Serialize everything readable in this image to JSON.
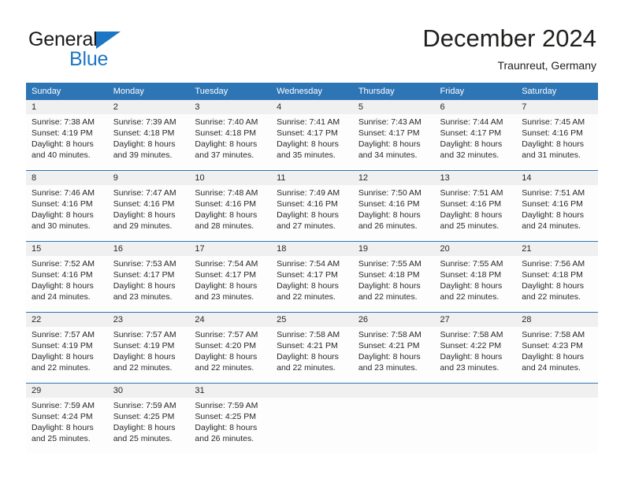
{
  "logo": {
    "word_dark": "General",
    "word_blue": "Blue",
    "triangle_icon": "triangle-icon",
    "accent_color": "#1d76c4"
  },
  "header": {
    "title": "December 2024",
    "subtitle": "Traunreut, Germany"
  },
  "colors": {
    "header_blue": "#2e75b6",
    "daynum_band": "#f0f0f0",
    "text": "#282828"
  },
  "calendar": {
    "weekday_headers": [
      "Sunday",
      "Monday",
      "Tuesday",
      "Wednesday",
      "Thursday",
      "Friday",
      "Saturday"
    ],
    "weeks": [
      [
        {
          "day": "1",
          "lines": [
            "Sunrise: 7:38 AM",
            "Sunset: 4:19 PM",
            "Daylight: 8 hours",
            "and 40 minutes."
          ]
        },
        {
          "day": "2",
          "lines": [
            "Sunrise: 7:39 AM",
            "Sunset: 4:18 PM",
            "Daylight: 8 hours",
            "and 39 minutes."
          ]
        },
        {
          "day": "3",
          "lines": [
            "Sunrise: 7:40 AM",
            "Sunset: 4:18 PM",
            "Daylight: 8 hours",
            "and 37 minutes."
          ]
        },
        {
          "day": "4",
          "lines": [
            "Sunrise: 7:41 AM",
            "Sunset: 4:17 PM",
            "Daylight: 8 hours",
            "and 35 minutes."
          ]
        },
        {
          "day": "5",
          "lines": [
            "Sunrise: 7:43 AM",
            "Sunset: 4:17 PM",
            "Daylight: 8 hours",
            "and 34 minutes."
          ]
        },
        {
          "day": "6",
          "lines": [
            "Sunrise: 7:44 AM",
            "Sunset: 4:17 PM",
            "Daylight: 8 hours",
            "and 32 minutes."
          ]
        },
        {
          "day": "7",
          "lines": [
            "Sunrise: 7:45 AM",
            "Sunset: 4:16 PM",
            "Daylight: 8 hours",
            "and 31 minutes."
          ]
        }
      ],
      [
        {
          "day": "8",
          "lines": [
            "Sunrise: 7:46 AM",
            "Sunset: 4:16 PM",
            "Daylight: 8 hours",
            "and 30 minutes."
          ]
        },
        {
          "day": "9",
          "lines": [
            "Sunrise: 7:47 AM",
            "Sunset: 4:16 PM",
            "Daylight: 8 hours",
            "and 29 minutes."
          ]
        },
        {
          "day": "10",
          "lines": [
            "Sunrise: 7:48 AM",
            "Sunset: 4:16 PM",
            "Daylight: 8 hours",
            "and 28 minutes."
          ]
        },
        {
          "day": "11",
          "lines": [
            "Sunrise: 7:49 AM",
            "Sunset: 4:16 PM",
            "Daylight: 8 hours",
            "and 27 minutes."
          ]
        },
        {
          "day": "12",
          "lines": [
            "Sunrise: 7:50 AM",
            "Sunset: 4:16 PM",
            "Daylight: 8 hours",
            "and 26 minutes."
          ]
        },
        {
          "day": "13",
          "lines": [
            "Sunrise: 7:51 AM",
            "Sunset: 4:16 PM",
            "Daylight: 8 hours",
            "and 25 minutes."
          ]
        },
        {
          "day": "14",
          "lines": [
            "Sunrise: 7:51 AM",
            "Sunset: 4:16 PM",
            "Daylight: 8 hours",
            "and 24 minutes."
          ]
        }
      ],
      [
        {
          "day": "15",
          "lines": [
            "Sunrise: 7:52 AM",
            "Sunset: 4:16 PM",
            "Daylight: 8 hours",
            "and 24 minutes."
          ]
        },
        {
          "day": "16",
          "lines": [
            "Sunrise: 7:53 AM",
            "Sunset: 4:17 PM",
            "Daylight: 8 hours",
            "and 23 minutes."
          ]
        },
        {
          "day": "17",
          "lines": [
            "Sunrise: 7:54 AM",
            "Sunset: 4:17 PM",
            "Daylight: 8 hours",
            "and 23 minutes."
          ]
        },
        {
          "day": "18",
          "lines": [
            "Sunrise: 7:54 AM",
            "Sunset: 4:17 PM",
            "Daylight: 8 hours",
            "and 22 minutes."
          ]
        },
        {
          "day": "19",
          "lines": [
            "Sunrise: 7:55 AM",
            "Sunset: 4:18 PM",
            "Daylight: 8 hours",
            "and 22 minutes."
          ]
        },
        {
          "day": "20",
          "lines": [
            "Sunrise: 7:55 AM",
            "Sunset: 4:18 PM",
            "Daylight: 8 hours",
            "and 22 minutes."
          ]
        },
        {
          "day": "21",
          "lines": [
            "Sunrise: 7:56 AM",
            "Sunset: 4:18 PM",
            "Daylight: 8 hours",
            "and 22 minutes."
          ]
        }
      ],
      [
        {
          "day": "22",
          "lines": [
            "Sunrise: 7:57 AM",
            "Sunset: 4:19 PM",
            "Daylight: 8 hours",
            "and 22 minutes."
          ]
        },
        {
          "day": "23",
          "lines": [
            "Sunrise: 7:57 AM",
            "Sunset: 4:19 PM",
            "Daylight: 8 hours",
            "and 22 minutes."
          ]
        },
        {
          "day": "24",
          "lines": [
            "Sunrise: 7:57 AM",
            "Sunset: 4:20 PM",
            "Daylight: 8 hours",
            "and 22 minutes."
          ]
        },
        {
          "day": "25",
          "lines": [
            "Sunrise: 7:58 AM",
            "Sunset: 4:21 PM",
            "Daylight: 8 hours",
            "and 22 minutes."
          ]
        },
        {
          "day": "26",
          "lines": [
            "Sunrise: 7:58 AM",
            "Sunset: 4:21 PM",
            "Daylight: 8 hours",
            "and 23 minutes."
          ]
        },
        {
          "day": "27",
          "lines": [
            "Sunrise: 7:58 AM",
            "Sunset: 4:22 PM",
            "Daylight: 8 hours",
            "and 23 minutes."
          ]
        },
        {
          "day": "28",
          "lines": [
            "Sunrise: 7:58 AM",
            "Sunset: 4:23 PM",
            "Daylight: 8 hours",
            "and 24 minutes."
          ]
        }
      ],
      [
        {
          "day": "29",
          "lines": [
            "Sunrise: 7:59 AM",
            "Sunset: 4:24 PM",
            "Daylight: 8 hours",
            "and 25 minutes."
          ]
        },
        {
          "day": "30",
          "lines": [
            "Sunrise: 7:59 AM",
            "Sunset: 4:25 PM",
            "Daylight: 8 hours",
            "and 25 minutes."
          ]
        },
        {
          "day": "31",
          "lines": [
            "Sunrise: 7:59 AM",
            "Sunset: 4:25 PM",
            "Daylight: 8 hours",
            "and 26 minutes."
          ]
        },
        {
          "day": "",
          "lines": []
        },
        {
          "day": "",
          "lines": []
        },
        {
          "day": "",
          "lines": []
        },
        {
          "day": "",
          "lines": []
        }
      ]
    ]
  }
}
